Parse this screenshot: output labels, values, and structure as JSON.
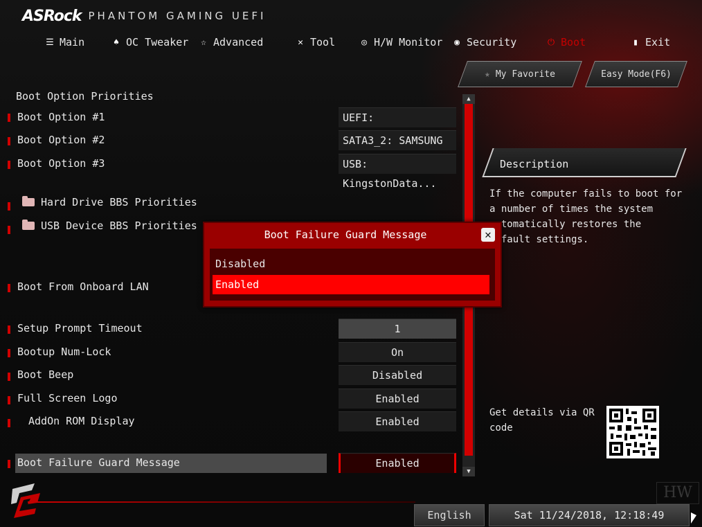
{
  "brand": {
    "logo": "ASRock",
    "subtitle": "PHANTOM GAMING UEFI"
  },
  "nav": [
    {
      "label": "Main",
      "icon": "list-icon"
    },
    {
      "label": "OC Tweaker",
      "icon": "flame-icon"
    },
    {
      "label": "Advanced",
      "icon": "star-icon"
    },
    {
      "label": "Tool",
      "icon": "tools-icon"
    },
    {
      "label": "H/W Monitor",
      "icon": "monitor-icon"
    },
    {
      "label": "Security",
      "icon": "shield-icon"
    },
    {
      "label": "Boot",
      "icon": "power-icon",
      "active": true
    },
    {
      "label": "Exit",
      "icon": "exit-icon"
    }
  ],
  "favorites": {
    "my_favorite": "My Favorite",
    "easy_mode": "Easy Mode(F6)"
  },
  "boot": {
    "section_title": "Boot Option Priorities",
    "option1": {
      "label": "Boot Option #1",
      "value": "UEFI: KingstonDat..."
    },
    "option2": {
      "label": "Boot Option #2",
      "value": "SATA3_2: SAMSUNG ..."
    },
    "option3": {
      "label": "Boot Option #3",
      "value": "USB: KingstonData..."
    },
    "hdd_bbs": "Hard Drive BBS Priorities",
    "usb_bbs": "USB Device BBS Priorities",
    "onboard_lan": "Boot From Onboard LAN",
    "setup_prompt": {
      "label": "Setup Prompt Timeout",
      "value": "1"
    },
    "numlock": {
      "label": "Bootup Num-Lock",
      "value": "On"
    },
    "beep": {
      "label": "Boot Beep",
      "value": "Disabled"
    },
    "fullscreen": {
      "label": "Full Screen Logo",
      "value": "Enabled"
    },
    "addon": {
      "label": "AddOn ROM Display",
      "value": "Enabled"
    },
    "guard": {
      "label": "Boot Failure Guard Message",
      "value": "Enabled"
    }
  },
  "description": {
    "title": "Description",
    "text": "If the computer fails to boot for a number of times the system automatically restores the default settings.",
    "qr_text": "Get details via QR code"
  },
  "popup": {
    "title": "Boot Failure Guard Message",
    "options": [
      "Disabled",
      "Enabled"
    ],
    "selected": "Enabled"
  },
  "footer": {
    "language": "English",
    "datetime": "Sat 11/24/2018, 12:18:49"
  },
  "colors": {
    "accent": "#d10000",
    "selected_option": "#ff0000",
    "popup_bg": "#9a0000"
  }
}
